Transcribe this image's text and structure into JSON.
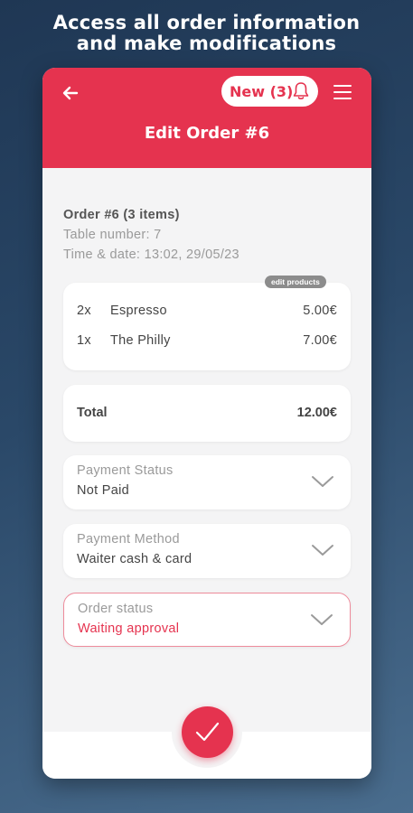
{
  "promo": {
    "line1": "Access all order information",
    "line2": "and make modifications"
  },
  "header": {
    "title": "Edit Order #6",
    "new_label": "New (3)",
    "back_icon": "arrow-left-icon",
    "bell_icon": "bell-icon",
    "menu_icon": "hamburger-menu-icon",
    "accent": "#e5334f"
  },
  "order": {
    "summary": "Order #6 (3 items)",
    "table": "Table number: 7",
    "time": "Time & date: 13:02, 29/05/23"
  },
  "products": {
    "edit_label": "edit products",
    "items": [
      {
        "qty": "2x",
        "name": "Espresso",
        "price": "5.00€"
      },
      {
        "qty": "1x",
        "name": "The Philly",
        "price": "7.00€"
      }
    ]
  },
  "total": {
    "label": "Total",
    "value": "12.00€"
  },
  "payment_status": {
    "label": "Payment Status",
    "value": "Not Paid"
  },
  "payment_method": {
    "label": "Payment Method",
    "value": "Waiter cash & card"
  },
  "order_status": {
    "label": "Order status",
    "value": "Waiting approval"
  },
  "confirm": {
    "icon": "checkmark-icon"
  }
}
